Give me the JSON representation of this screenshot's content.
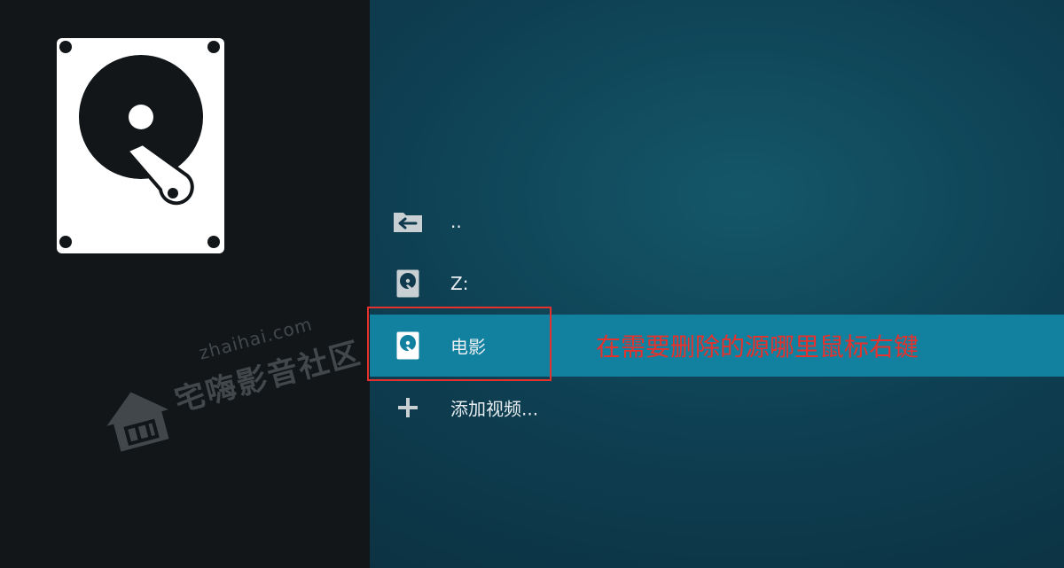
{
  "list": {
    "items": [
      {
        "label": "..",
        "icon": "back-folder-icon"
      },
      {
        "label": "Z:",
        "icon": "hard-drive-icon"
      },
      {
        "label": "电影",
        "icon": "hard-drive-icon",
        "selected": true
      },
      {
        "label": "添加视频...",
        "icon": "plus-icon"
      }
    ]
  },
  "annotation": {
    "text": "在需要删除的源哪里鼠标右键",
    "color": "#e5322d"
  },
  "watermark": {
    "domain": "zhaihai.com",
    "name": "宅嗨影音社区"
  },
  "colors": {
    "selected_row": "#12809f",
    "left_panel": "#121619",
    "highlight": "#e5322d"
  }
}
